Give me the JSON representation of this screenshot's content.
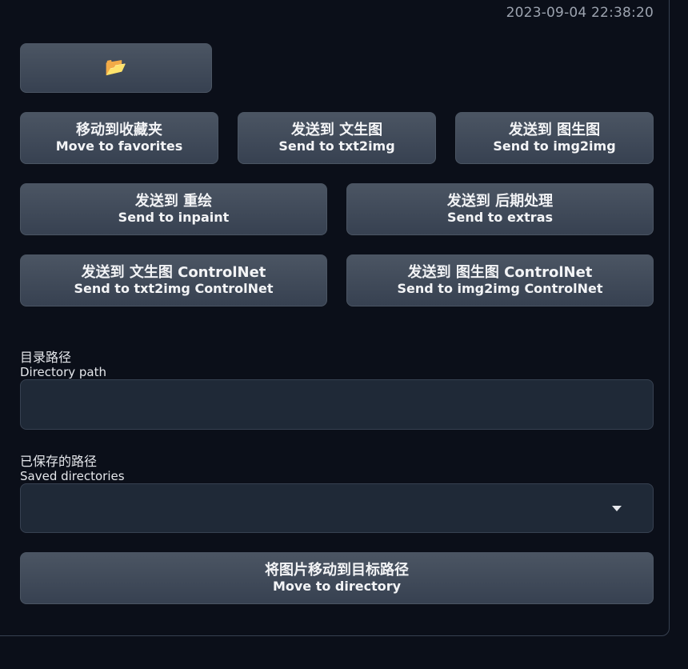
{
  "timestamp": "2023-09-04 22:38:20",
  "folder_button": {
    "icon": "folder-icon",
    "glyph": "📂"
  },
  "buttons": {
    "favorites": {
      "zh": "移动到收藏夹",
      "en": "Move to favorites"
    },
    "txt2img": {
      "zh": "发送到 文生图",
      "en": "Send to txt2img"
    },
    "img2img": {
      "zh": "发送到 图生图",
      "en": "Send to img2img"
    },
    "inpaint": {
      "zh": "发送到 重绘",
      "en": "Send to inpaint"
    },
    "extras": {
      "zh": "发送到 后期处理",
      "en": "Send to extras"
    },
    "txt2img_controlnet": {
      "zh": "发送到 文生图 ControlNet",
      "en": "Send to txt2img ControlNet"
    },
    "img2img_controlnet": {
      "zh": "发送到 图生图 ControlNet",
      "en": "Send to img2img ControlNet"
    },
    "move_to_directory": {
      "zh": "将图片移动到目标路径",
      "en": "Move to directory"
    }
  },
  "directory_path": {
    "label_zh": "目录路径",
    "label_en": "Directory path",
    "value": ""
  },
  "saved_directories": {
    "label_zh": "已保存的路径",
    "label_en": "Saved directories",
    "selected": ""
  }
}
